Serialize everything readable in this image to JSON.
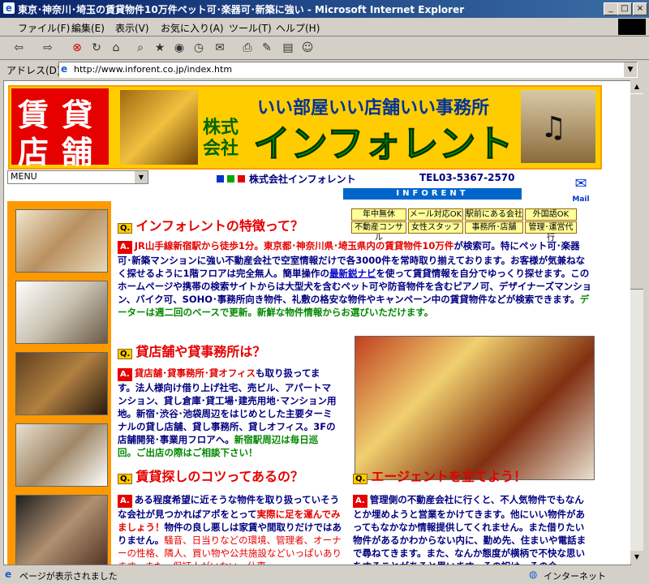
{
  "window": {
    "title": "東京･神奈川･埼玉の賃貸物件10万件ペット可･楽器可･新築に強い - Microsoft Internet Explorer"
  },
  "menu": [
    "ファイル(F)",
    "編集(E)",
    "表示(V)",
    "お気に入り(A)",
    "ツール(T)",
    "ヘルプ(H)"
  ],
  "address": {
    "label": "アドレス(D)",
    "url": "http://www.inforent.co.jp/index.htm"
  },
  "status": {
    "left": "ページが表示されました",
    "right": "インターネット"
  },
  "banner": {
    "kanji": [
      "賃",
      "貸",
      "店",
      "舗"
    ],
    "slogan": "いい部屋いい店舗いい事務所",
    "kaisha": "株式会社",
    "name": "インフォレント"
  },
  "nav": {
    "menu_select": "MENU",
    "company": "株式会社インフォレント",
    "tel": "TEL03-5367-2570",
    "logo_text": "INFORENT",
    "mail": "Mail"
  },
  "features": [
    "年中無休",
    "メール対応OK",
    "駅前にある会社",
    "外国語OK",
    "不動産コンサル",
    "女性スタッフ",
    "事務所･店舗",
    "管理･運営代行"
  ],
  "sections": {
    "s1": {
      "q": "Q.",
      "title": "インフォレントの特徴って？",
      "a": "A.",
      "text1": "JR山手線新宿駅から徒歩1分。東京都･神奈川県･埼玉県内の賃貸物件10万件",
      "text2": "が検索可。特にペット可･楽器可･新築マンションに強い不動産会社で空室情報だけで各3000件を常時取り揃えております。お客様が気兼ねなく探せるように1階フロアは完全無人。簡単操作の",
      "link": "最新鋭ナビ",
      "text3": "を使って賃貸情報を自分でゆっくり探せます。このホームページや携帯の検索サイトからは大型犬を含むペット可や防音物件を含むピアノ可、デザイナーズマンション、バイク可、SOHO･事務所向き物件、礼敷の格安な物件やキャンペーン中の賃貸物件などが検索できます。",
      "text4": "データーは週二回のベースで更新。新鮮な物件情報からお選びいただけます。"
    },
    "s2": {
      "q": "Q.",
      "title": "貸店舗や貸事務所は？",
      "a": "A.",
      "text1": "貸店舗･貸事務所･貸オフィス",
      "text2": "も取り扱ってます。法人様向け借り上げ社宅、売ビル、アパートマンション、貸し倉庫･貸工場･建売用地･マンション用地。新宿･渋谷･池袋周辺をはじめとした主要ターミナルの貸し店舗、貸し事務所、貸しオフィス。3Fの店舗開発･事業用フロアへ。",
      "text3": "新宿駅周辺は毎日巡回。ご出店の際はご相談下さい！"
    },
    "s3": {
      "q": "Q.",
      "title": "賃貸探しのコツってあるの？",
      "a": "A.",
      "text1": "ある程度希望に近そうな物件を取り扱っていそうな会社が見つかればアポをとって",
      "text2": "実際に足を運んでみましょう！",
      "text3": "物件の良し悪しは家賃や間取りだけではありません。",
      "text4": "騒音、日当りなどの環境、管理者、オーナーの性格、隣人、買い物や公共施設などいっぱいあります。また、保証人がいない、仕事"
    },
    "s4": {
      "q": "Q.",
      "title": "エージェントを立てよう！",
      "a": "A.",
      "text1": "管理側の不動産会社に行くと、不人気物件でもなんとか埋めようと営業をかけてきます。他にいい物件があってもなかなか情報提供してくれません。また借りたい物件があるかわからない内に、勤め先、住まいや電話まで尋ねてきます。また、なんか態度が横柄で不快な思いをすることがあると思います。その訳は、その会"
    }
  }
}
